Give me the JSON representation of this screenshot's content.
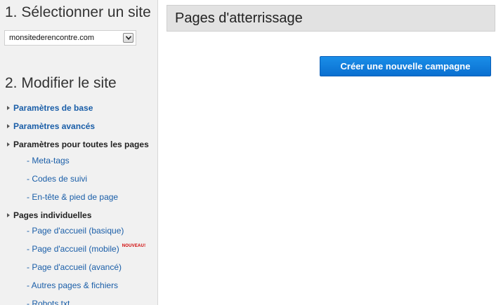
{
  "sidebar": {
    "step1_title": "1. Sélectionner un site",
    "site_select": {
      "value": "monsitederencontre.com"
    },
    "step2_title": "2. Modifier le site",
    "items": [
      {
        "label": "Paramètres de base"
      },
      {
        "label": "Paramètres avancés"
      },
      {
        "label": "Paramètres pour toutes les pages"
      },
      {
        "label": "- Meta-tags"
      },
      {
        "label": "- Codes de suivi"
      },
      {
        "label": "- En-tête & pied de page"
      },
      {
        "label": "Pages individuelles"
      },
      {
        "label": "- Page d'accueil (basique)"
      },
      {
        "label": "- Page d'accueil (mobile)",
        "badge": "NOUVEAU!"
      },
      {
        "label": "- Page d'accueil (avancé)"
      },
      {
        "label": "- Autres pages & fichiers"
      },
      {
        "label": "- Robots.txt"
      }
    ]
  },
  "main": {
    "header_title": "Pages d'atterrissage",
    "create_button": "Créer une nouvelle campagne"
  },
  "colors": {
    "link": "#1a5ea8",
    "button": "#0a7ddc",
    "badge": "#d00000"
  }
}
